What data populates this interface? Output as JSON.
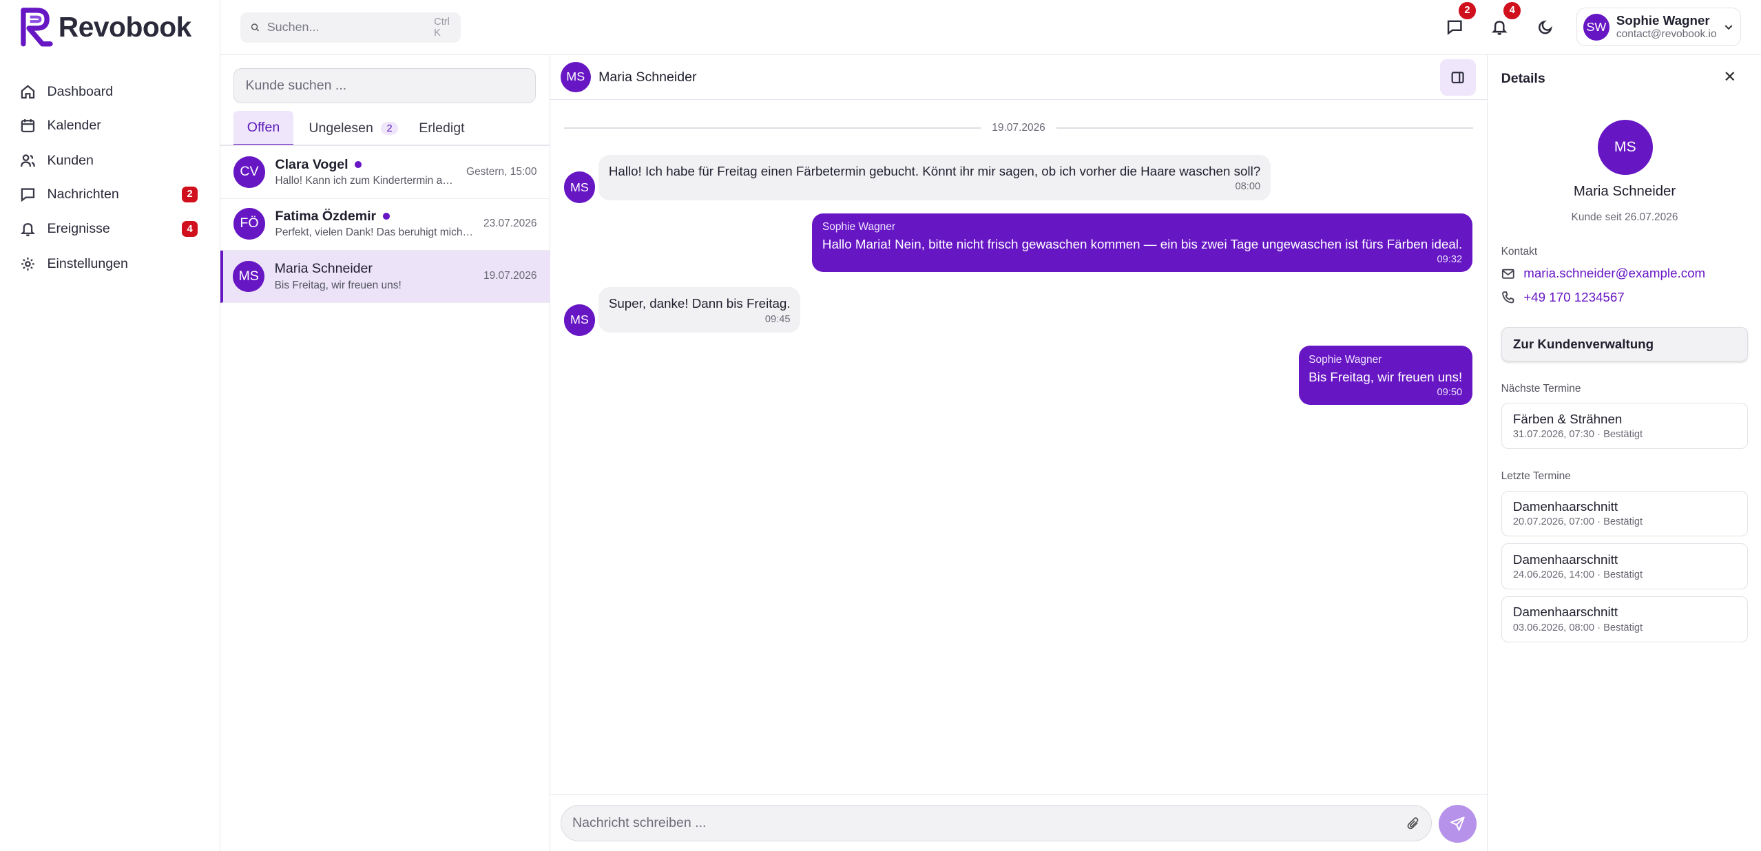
{
  "app": {
    "brand": "Revobook"
  },
  "sidebar": {
    "items": [
      {
        "label": "Dashboard",
        "icon": "home-icon",
        "badge": ""
      },
      {
        "label": "Kalender",
        "icon": "calendar-icon",
        "badge": ""
      },
      {
        "label": "Kunden",
        "icon": "users-icon",
        "badge": ""
      },
      {
        "label": "Nachrichten",
        "icon": "message-icon",
        "badge": "2"
      },
      {
        "label": "Ereignisse",
        "icon": "bell-icon",
        "badge": "4"
      },
      {
        "label": "Einstellungen",
        "icon": "gear-icon",
        "badge": ""
      }
    ]
  },
  "topbar": {
    "search": {
      "placeholder": "Suchen...",
      "shortcut": "Ctrl K"
    },
    "messages_badge": "2",
    "notifications_badge": "4",
    "user": {
      "initials": "SW",
      "name": "Sophie Wagner",
      "email": "contact@revobook.io"
    }
  },
  "conversations": {
    "search_placeholder": "Kunde suchen ...",
    "tabs": [
      {
        "label": "Offen",
        "count": ""
      },
      {
        "label": "Ungelesen",
        "count": "2"
      },
      {
        "label": "Erledigt",
        "count": ""
      }
    ],
    "items": [
      {
        "initials": "CV",
        "name": "Clara Vogel",
        "preview": "Hallo! Kann ich zum Kindertermin am Samstag meine Tochter mitbringen?",
        "date": "Gestern, 15:00",
        "unread": true
      },
      {
        "initials": "FÖ",
        "name": "Fatima Özdemir",
        "preview": "Perfekt, vielen Dank! Das beruhigt mich sehr.",
        "date": "23.07.2026",
        "unread": true
      },
      {
        "initials": "MS",
        "name": "Maria Schneider",
        "preview": "Bis Freitag, wir freuen uns!",
        "date": "19.07.2026",
        "unread": false
      }
    ]
  },
  "chat": {
    "contact": {
      "initials": "MS",
      "name": "Maria Schneider"
    },
    "date_divider": "19.07.2026",
    "messages": [
      {
        "direction": "in",
        "sender": "",
        "text": "Hallo! Ich habe für Freitag einen Färbetermin gebucht. Könnt ihr mir sagen, ob ich vorher die Haare waschen soll?",
        "time": "08:00"
      },
      {
        "direction": "out",
        "sender": "Sophie Wagner",
        "text": "Hallo Maria! Nein, bitte nicht frisch gewaschen kommen — ein bis zwei Tage ungewaschen ist fürs Färben ideal.",
        "time": "09:32"
      },
      {
        "direction": "in",
        "sender": "",
        "text": "Super, danke! Dann bis Freitag.",
        "time": "09:45"
      },
      {
        "direction": "out",
        "sender": "Sophie Wagner",
        "text": "Bis Freitag, wir freuen uns!",
        "time": "09:50"
      }
    ],
    "composer_placeholder": "Nachricht schreiben ..."
  },
  "details": {
    "title": "Details",
    "initials": "MS",
    "name": "Maria Schneider",
    "customer_since": "Kunde seit 26.07.2026",
    "contact_label": "Kontakt",
    "email": "maria.schneider@example.com",
    "phone": "+49 170 1234567",
    "crm_button": "Zur Kundenverwaltung",
    "next_label": "Nächste Termine",
    "next": [
      {
        "title": "Färben & Strähnen",
        "sub": "31.07.2026, 07:30 · Bestätigt"
      }
    ],
    "past_label": "Letzte Termine",
    "past": [
      {
        "title": "Damenhaarschnitt",
        "sub": "20.07.2026, 07:00 · Bestätigt"
      },
      {
        "title": "Damenhaarschnitt",
        "sub": "24.06.2026, 14:00 · Bestätigt"
      },
      {
        "title": "Damenhaarschnitt",
        "sub": "03.06.2026, 08:00 · Bestätigt"
      }
    ]
  },
  "colors": {
    "accent": "#6716c4",
    "badge": "#d0111d",
    "selected_bg": "#ece3f8"
  }
}
